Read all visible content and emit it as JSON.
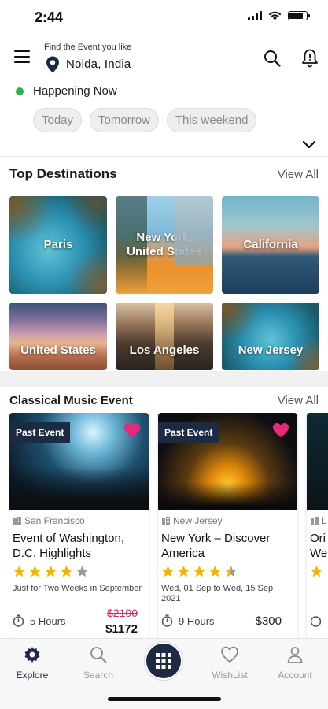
{
  "status_bar": {
    "time": "2:44"
  },
  "header": {
    "caption": "Find the Event you like",
    "location": "Noida, India"
  },
  "happening": {
    "label": "Happening Now",
    "chips": [
      "Today",
      "Tomorrow",
      "This weekend"
    ]
  },
  "destinations": {
    "title": "Top Destinations",
    "view_all": "View All",
    "items": [
      {
        "label": "Paris"
      },
      {
        "label": "New York, United States"
      },
      {
        "label": "California"
      },
      {
        "label": "United States"
      },
      {
        "label": "Los Angeles"
      },
      {
        "label": "New Jersey"
      }
    ]
  },
  "events": {
    "title": "Classical Music Event",
    "view_all": "View All",
    "cards": [
      {
        "badge": "Past Event",
        "city": "San Francisco",
        "title": "Event of Washington, D.C. Highlights",
        "rating": 4,
        "dates": "Just for Two Weeks in September",
        "duration": "5 Hours",
        "price_old": "$2100",
        "price_new": "$1172"
      },
      {
        "badge": "Past Event",
        "city": "New Jersey",
        "title": "New York – Discover America",
        "rating": 4.5,
        "dates": "Wed, 01 Sep to Wed, 15 Sep 2021",
        "duration": "9 Hours",
        "price": "$300"
      },
      {
        "city": "L",
        "title_line1": "Ori",
        "title_line2": "We"
      }
    ]
  },
  "bottom_nav": {
    "items": [
      "Explore",
      "Search",
      "WishList",
      "Account"
    ]
  },
  "colors": {
    "brand_navy": "#1c2a44",
    "live_green": "#2bb24c",
    "heart_pink": "#e8287a",
    "star_gold": "#f5b301",
    "sale_red": "#e0245e"
  }
}
